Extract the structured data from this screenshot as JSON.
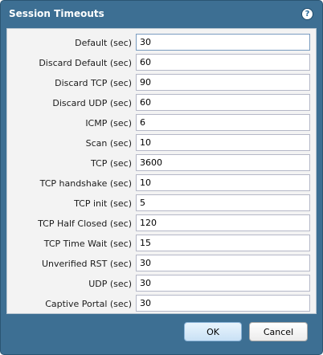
{
  "dialog": {
    "title": "Session Timeouts",
    "help_icon": "help-circle-icon",
    "help_glyph": "?"
  },
  "fields": [
    {
      "label": "Default (sec)",
      "value": "30"
    },
    {
      "label": "Discard Default (sec)",
      "value": "60"
    },
    {
      "label": "Discard TCP (sec)",
      "value": "90"
    },
    {
      "label": "Discard UDP (sec)",
      "value": "60"
    },
    {
      "label": "ICMP (sec)",
      "value": "6"
    },
    {
      "label": "Scan (sec)",
      "value": "10"
    },
    {
      "label": "TCP (sec)",
      "value": "3600"
    },
    {
      "label": "TCP handshake (sec)",
      "value": "10"
    },
    {
      "label": "TCP init (sec)",
      "value": "5"
    },
    {
      "label": "TCP Half Closed (sec)",
      "value": "120"
    },
    {
      "label": "TCP Time Wait (sec)",
      "value": "15"
    },
    {
      "label": "Unverified RST (sec)",
      "value": "30"
    },
    {
      "label": "UDP (sec)",
      "value": "30"
    },
    {
      "label": "Captive Portal (sec)",
      "value": "30"
    }
  ],
  "buttons": {
    "ok_label": "OK",
    "cancel_label": "Cancel"
  },
  "colors": {
    "dialog_bg": "#3d6f93",
    "panel_bg": "#f3f3f3"
  }
}
